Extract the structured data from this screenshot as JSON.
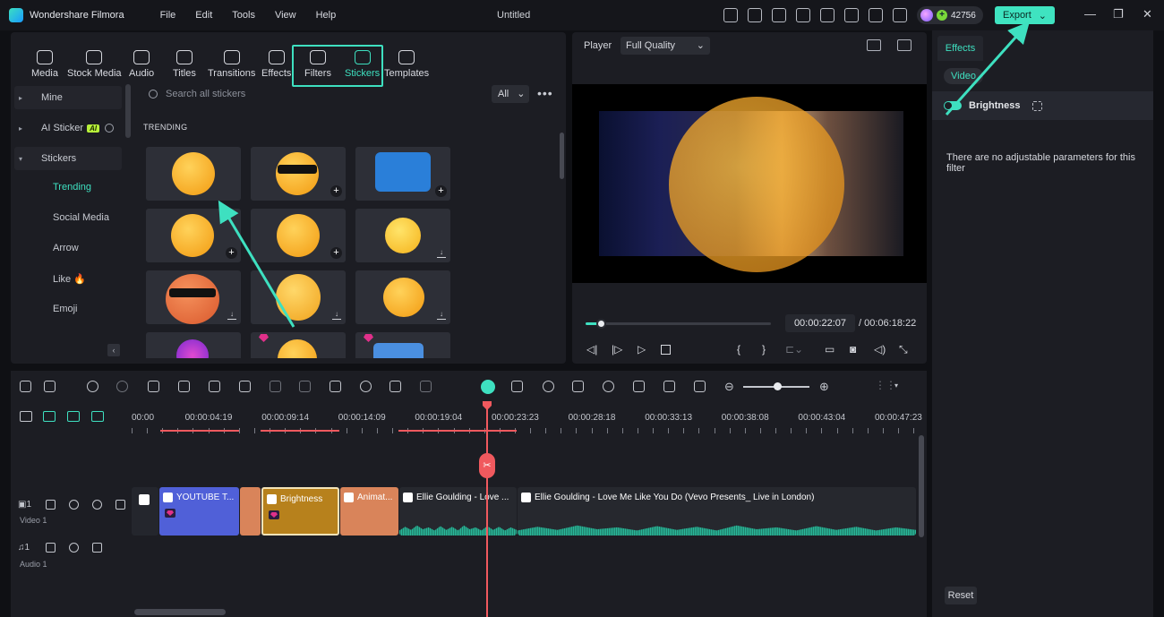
{
  "app": {
    "name": "Wondershare Filmora",
    "menus": [
      "File",
      "Edit",
      "Tools",
      "View",
      "Help"
    ],
    "document_title": "Untitled",
    "credits": "42756",
    "export_label": "Export"
  },
  "media_panel": {
    "tabs": [
      "Media",
      "Stock Media",
      "Audio",
      "Titles",
      "Transitions",
      "Effects",
      "Filters",
      "Stickers",
      "Templates"
    ],
    "active_tab": "Stickers",
    "tree": {
      "mine": "Mine",
      "ai_sticker": "AI Sticker",
      "ai_badge": "AI",
      "stickers": "Stickers",
      "sub": [
        "Trending",
        "Social Media",
        "Arrow",
        "Like",
        "Emoji"
      ],
      "like_suffix": "🔥"
    },
    "search_placeholder": "Search all stickers",
    "filter_value": "All",
    "section_title": "TRENDING"
  },
  "player": {
    "label": "Player",
    "quality": "Full Quality",
    "current_time": "00:00:22:07",
    "total_time": "/ 00:06:18:22",
    "progress": 0.08
  },
  "effects_panel": {
    "tab": "Effects",
    "subtab": "Video",
    "filter_name": "Brightness",
    "message": "There are no adjustable parameters for this filter",
    "reset_label": "Reset"
  },
  "timeline": {
    "ruler_labels": [
      "00:00",
      "00:00:04:19",
      "00:00:09:14",
      "00:00:14:09",
      "00:00:19:04",
      "00:00:23:23",
      "00:00:28:18",
      "00:00:33:13",
      "00:00:38:08",
      "00:00:43:04",
      "00:00:47:23"
    ],
    "tracks": {
      "video": "Video 1",
      "audio": "Audio 1",
      "video_num": "1",
      "audio_num": "1"
    },
    "clips": {
      "youtube": "YOUTUBE T...",
      "brightness": "Brightness",
      "animated": "Animat...",
      "ellie1": "Ellie Goulding - Love ...",
      "ellie2": "Ellie Goulding - Love Me Like You Do (Vevo Presents_ Live in London)"
    }
  },
  "colors": {
    "accent": "#3ee0c0",
    "playhead": "#f0595e",
    "youtube_clip": "#5060d8",
    "brightness_clip": "#b7811c",
    "sticker_clip": "#d9845a"
  }
}
